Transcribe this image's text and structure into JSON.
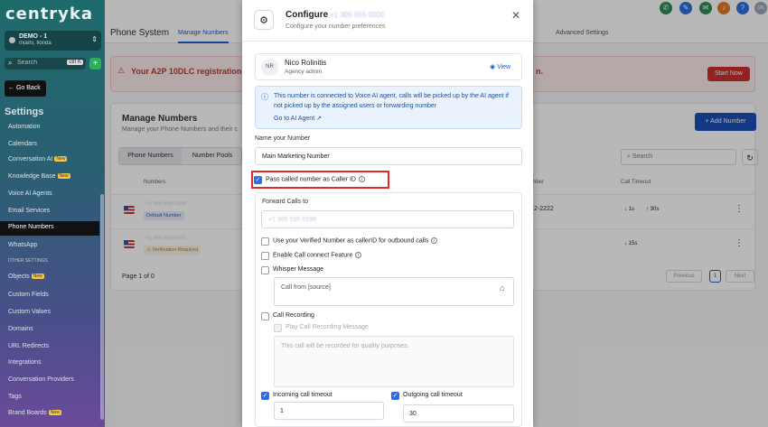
{
  "sidebar": {
    "brand": "centryka",
    "account_name": "DEMO - 1",
    "account_location": "miami, florida",
    "search_placeholder": "Search",
    "search_shortcut": "ctrl K",
    "go_back": "Go Back",
    "section_title": "Settings",
    "items": [
      {
        "label": "Automation",
        "badge": ""
      },
      {
        "label": "Calendars",
        "badge": ""
      },
      {
        "label": "Conversation AI",
        "badge": "New"
      },
      {
        "label": "Knowledge Base",
        "badge": "New"
      },
      {
        "label": "Voice AI Agents",
        "badge": ""
      },
      {
        "label": "Email Services",
        "badge": ""
      },
      {
        "label": "Phone Numbers",
        "badge": ""
      },
      {
        "label": "WhatsApp",
        "badge": ""
      },
      {
        "label": "OTHER SETTINGS",
        "badge": ""
      },
      {
        "label": "Objects",
        "badge": "New"
      },
      {
        "label": "Custom Fields",
        "badge": ""
      },
      {
        "label": "Custom Values",
        "badge": ""
      },
      {
        "label": "Domains",
        "badge": ""
      },
      {
        "label": "URL Redirects",
        "badge": ""
      },
      {
        "label": "Integrations",
        "badge": ""
      },
      {
        "label": "Conversation Providers",
        "badge": ""
      },
      {
        "label": "Tags",
        "badge": ""
      },
      {
        "label": "Brand Boards",
        "badge": "New"
      }
    ]
  },
  "header": {
    "page_title": "Phone System",
    "tab_manage": "Manage Numbers",
    "tab_advanced": "Advanced Settings",
    "avatar_initials": "SN"
  },
  "banner": {
    "text": "Your A2P 10DLC registration is i",
    "text_tail": "n.",
    "button": "Start Now"
  },
  "manage": {
    "title": "Manage Numbers",
    "subtitle": "Manage your Phone Numbers and their c",
    "add_button": "Add Number",
    "seg_phone": "Phone Numbers",
    "seg_pools": "Number Pools",
    "search_placeholder": "Search",
    "col_numbers": "Numbers",
    "col_number": "umber",
    "col_timeout": "Call Timeout",
    "rows": [
      {
        "number": "+1 305 555 0100",
        "tag": "Default Number",
        "num_tail": "2-2222",
        "t1": "1s",
        "t2": "30s"
      },
      {
        "number": "+1 305 555 0101",
        "tag": "Verification Required",
        "num_tail": "",
        "t1": "",
        "t2": "15s"
      }
    ],
    "page_of": "Page 1 of 0",
    "prev": "Previous",
    "page": "1",
    "next": "Next"
  },
  "modal": {
    "title": "Configure",
    "title_number": "+1 305 555 0000",
    "subtitle": "Configure your number preferences",
    "agent_initials": "NR",
    "agent_name": "Nico Rolinitis",
    "agent_role": "Agency admin",
    "view": "View",
    "info_text": "This number is connected to Voice AI agent, calls will be picked up by the AI agent if not picked up by the assigned users or forwarding number",
    "info_link": "Go to AI Agent",
    "name_label": "Name your Number",
    "name_value": "Main Marketing Number",
    "pass_caller_id": "Pass called number as Caller ID",
    "forward_label": "Forward Calls to",
    "forward_value": "+1 305 555 0199",
    "use_verified": "Use your Verified Number as callerID for outbound calls",
    "call_connect": "Enable Call connect Feature",
    "whisper_label": "Whisper Message",
    "whisper_value": "Call from [source]",
    "call_recording": "Call Recording",
    "play_recording": "Play Call Recording Message",
    "recording_placeholder": "This call will be recorded for quality purposes.",
    "incoming_timeout_label": "Incoming call timeout",
    "incoming_timeout_value": "1",
    "outgoing_timeout_label": "Outgoing call timeout",
    "outgoing_timeout_value": "30"
  },
  "colors": {
    "primary": "#1d5fd6",
    "danger": "#c9302c",
    "highlight_box": "#e0292b"
  }
}
